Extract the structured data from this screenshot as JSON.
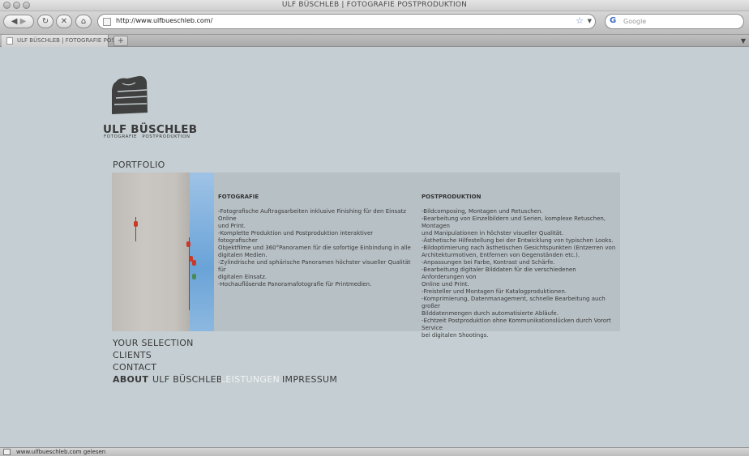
{
  "window": {
    "title": "ULF BÜSCHLEB | FOTOGRAFIE POSTPRODUKTION"
  },
  "toolbar": {
    "url": "http://www.ulfbueschleb.com/",
    "search_placeholder": "Google"
  },
  "tab": {
    "label": "ULF BÜSCHLEB | FOTOGRAFIE POS...",
    "new_tab": "+"
  },
  "logo": {
    "name": "ULF BÜSCHLEB",
    "sub": "FOTOGRAFIE POSTPRODUKTION"
  },
  "portfolio": {
    "label": "PORTFOLIO"
  },
  "fotografie": {
    "title": "FOTOGRAFIE",
    "body": "-Fotografische Auftragsarbeiten inklusive Finishing für den Einsatz Online\nund Print.\n-Komplette Produktion und Postproduktion interaktiver fotografischer\nObjektfilme und 360°Panoramen für die sofortige Einbindung in alle\ndigitalen Medien.\n-Zylindrische und sphärische Panoramen höchster visueller Qualität für\ndigitalen Einsatz.\n-Hochauflösende Panoramafotografie für Printmedien."
  },
  "postproduktion": {
    "title": "POSTPRODUKTION",
    "body": "-Bildcomposing, Montagen und Retuschen.\n-Bearbeitung von Einzelbildern und Serien, komplexe Retuschen, Montagen\nund Manipulationen in höchster visueller Qualität.\n-Ästhetische Hilfestellung bei der Entwicklung von typischen Looks.\n-Bildoptimierung nach ästhetischen Gesichtspunkten (Entzerren von\nArchitekturmotiven, Entfernen von Gegenständen etc.).\n-Anpassungen bei Farbe, Kontrast und Schärfe.\n-Bearbeitung digitaler Bilddaten für die verschiedenen Anforderungen von\nOnline und Print.\n-Freisteller und Montagen für Katalogproduktionen.\n-Komprimierung, Datenmanagement, schnelle Bearbeitung auch großer\nBilddatenmengen durch automatisierte Abläufe.\n-Echtzeit Postproduktion ohne Kommunikationslücken durch Vorort Service\nbei digitalen Shootings."
  },
  "menu": {
    "your_selection": "YOUR SELECTION",
    "clients": "CLIENTS",
    "contact": "CONTACT",
    "about": "ABOUT",
    "ulf": "ULF BÜSCHLEB",
    "leistungen": "LEISTUNGEN",
    "impressum": "IMPRESSUM"
  },
  "status": {
    "text": "www.ulfbueschleb.com gelesen"
  },
  "colors": {
    "background": "#c5ced2",
    "panel": "#b7c0c5",
    "text": "#3a3a3a",
    "active": "#f2f4f5"
  }
}
